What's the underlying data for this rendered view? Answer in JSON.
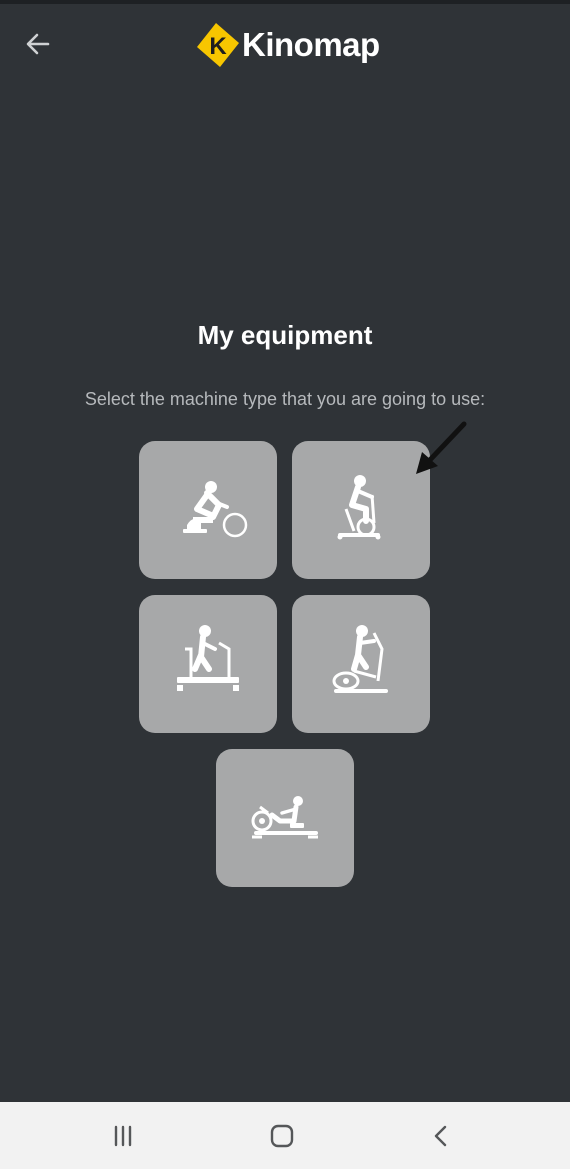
{
  "header": {
    "back_icon": "arrow-left-icon",
    "logo_text": "Kinomap",
    "logo_colors": {
      "mark": "#f7c600",
      "text": "#ffffff"
    }
  },
  "main": {
    "title": "My equipment",
    "subtitle": "Select the machine type that you are going to use:",
    "tiles": [
      {
        "icon": "bike-trainer-icon"
      },
      {
        "icon": "exercise-bike-icon"
      },
      {
        "icon": "treadmill-icon"
      },
      {
        "icon": "elliptical-icon"
      },
      {
        "icon": "rowing-machine-icon"
      }
    ],
    "annotation_icon": "arrow-pointer-icon"
  },
  "system_nav": {
    "items": [
      "recent-apps-icon",
      "home-icon",
      "back-icon"
    ]
  },
  "colors": {
    "background": "#2f3337",
    "tile": "#a7a8a9",
    "navbar": "#f2f2f2"
  }
}
